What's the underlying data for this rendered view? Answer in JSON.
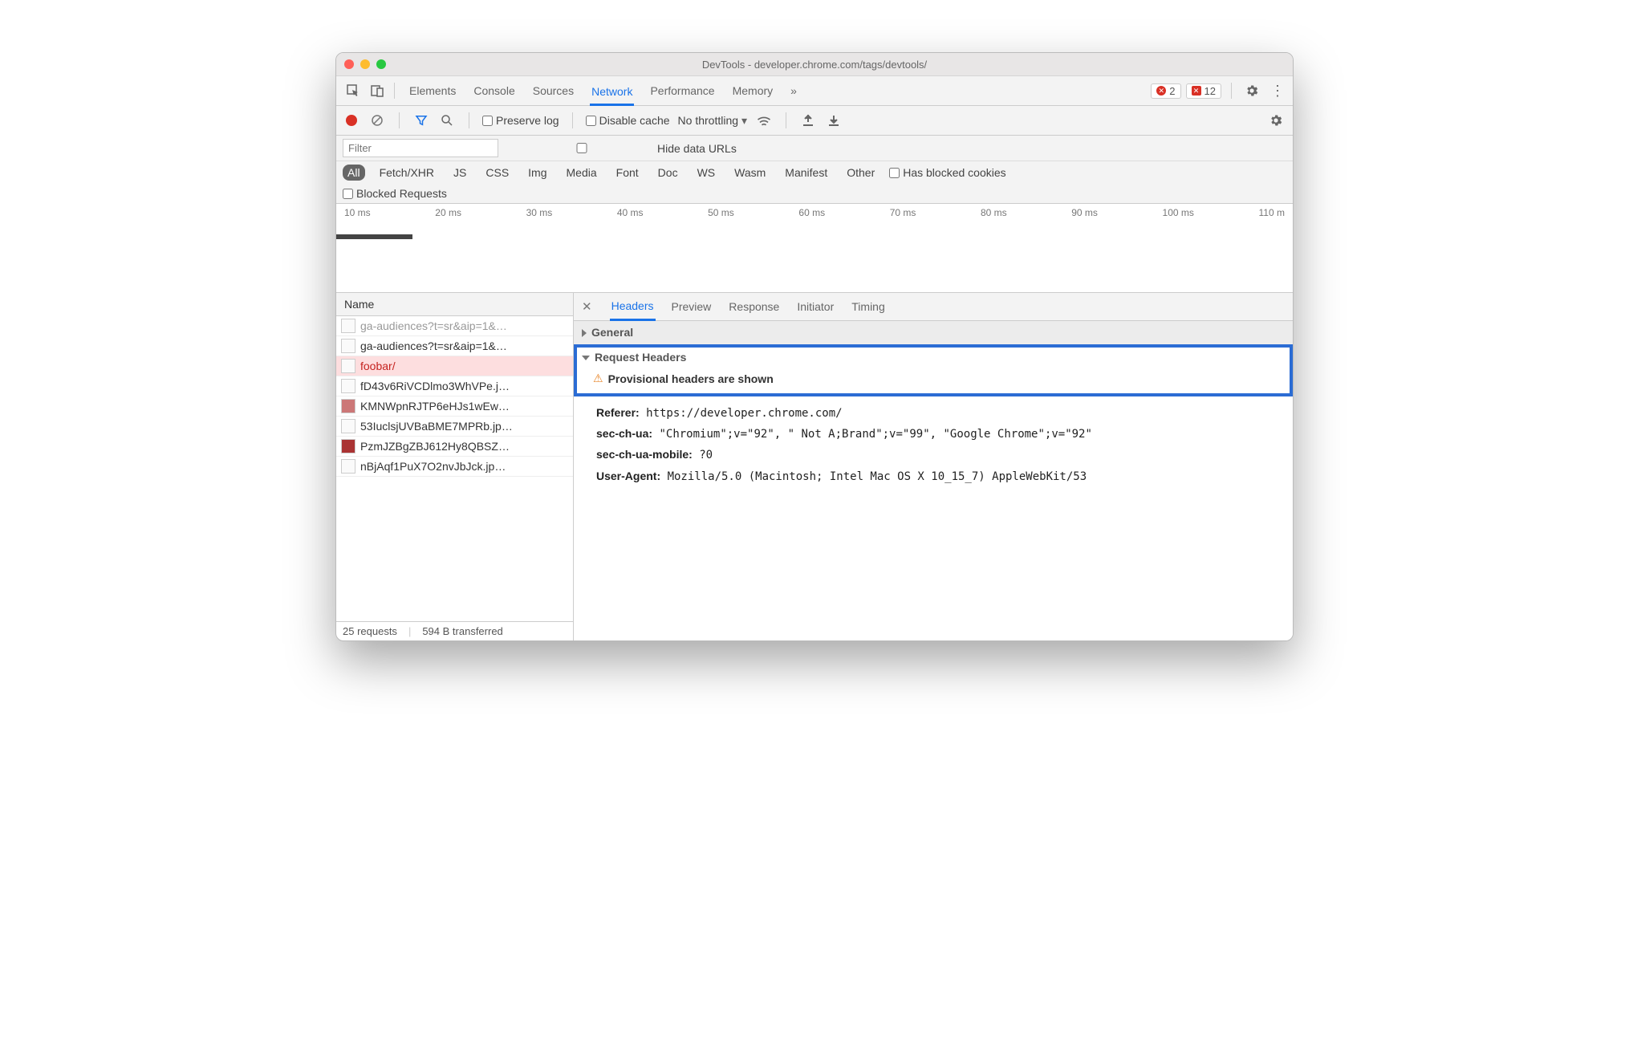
{
  "window": {
    "title": "DevTools - developer.chrome.com/tags/devtools/"
  },
  "tabs": {
    "items": [
      "Elements",
      "Console",
      "Sources",
      "Network",
      "Performance",
      "Memory"
    ],
    "active": "Network"
  },
  "errors": {
    "circle": "2",
    "square": "12"
  },
  "subbar": {
    "preserve": "Preserve log",
    "disable_cache": "Disable cache",
    "throttling": "No throttling"
  },
  "filter": {
    "placeholder": "Filter",
    "hide_urls": "Hide data URLs"
  },
  "types": {
    "all": "All",
    "items": [
      "Fetch/XHR",
      "JS",
      "CSS",
      "Img",
      "Media",
      "Font",
      "Doc",
      "WS",
      "Wasm",
      "Manifest",
      "Other"
    ],
    "blocked_cookies": "Has blocked cookies"
  },
  "blocked": {
    "label": "Blocked Requests"
  },
  "timeline": {
    "ticks": [
      "10 ms",
      "20 ms",
      "30 ms",
      "40 ms",
      "50 ms",
      "60 ms",
      "70 ms",
      "80 ms",
      "90 ms",
      "100 ms",
      "110 m"
    ]
  },
  "sidebar": {
    "header": "Name",
    "rows": [
      {
        "name": "ga-audiences?t=sr&aip=1&…",
        "dim": true
      },
      {
        "name": "ga-audiences?t=sr&aip=1&…"
      },
      {
        "name": "foobar/",
        "selected": true
      },
      {
        "name": "fD43v6RiVCDlmo3WhVPe.j…"
      },
      {
        "name": "KMNWpnRJTP6eHJs1wEw…"
      },
      {
        "name": "53IuclsjUVBaBME7MPRb.jp…"
      },
      {
        "name": "PzmJZBgZBJ612Hy8QBSZ…"
      },
      {
        "name": "nBjAqf1PuX7O2nvJbJck.jp…"
      }
    ],
    "status": {
      "requests": "25 requests",
      "transferred": "594 B transferred"
    }
  },
  "detail": {
    "tabs": [
      "Headers",
      "Preview",
      "Response",
      "Initiator",
      "Timing"
    ],
    "active": "Headers",
    "general": "General",
    "request_headers": "Request Headers",
    "provisional": "Provisional headers are shown",
    "headers": {
      "referer_k": "Referer:",
      "referer_v": "https://developer.chrome.com/",
      "ua_k": "sec-ch-ua:",
      "ua_v": "\"Chromium\";v=\"92\", \" Not A;Brand\";v=\"99\", \"Google Chrome\";v=\"92\"",
      "mob_k": "sec-ch-ua-mobile:",
      "mob_v": "?0",
      "uagent_k": "User-Agent:",
      "uagent_v": "Mozilla/5.0 (Macintosh; Intel Mac OS X 10_15_7) AppleWebKit/53"
    }
  }
}
